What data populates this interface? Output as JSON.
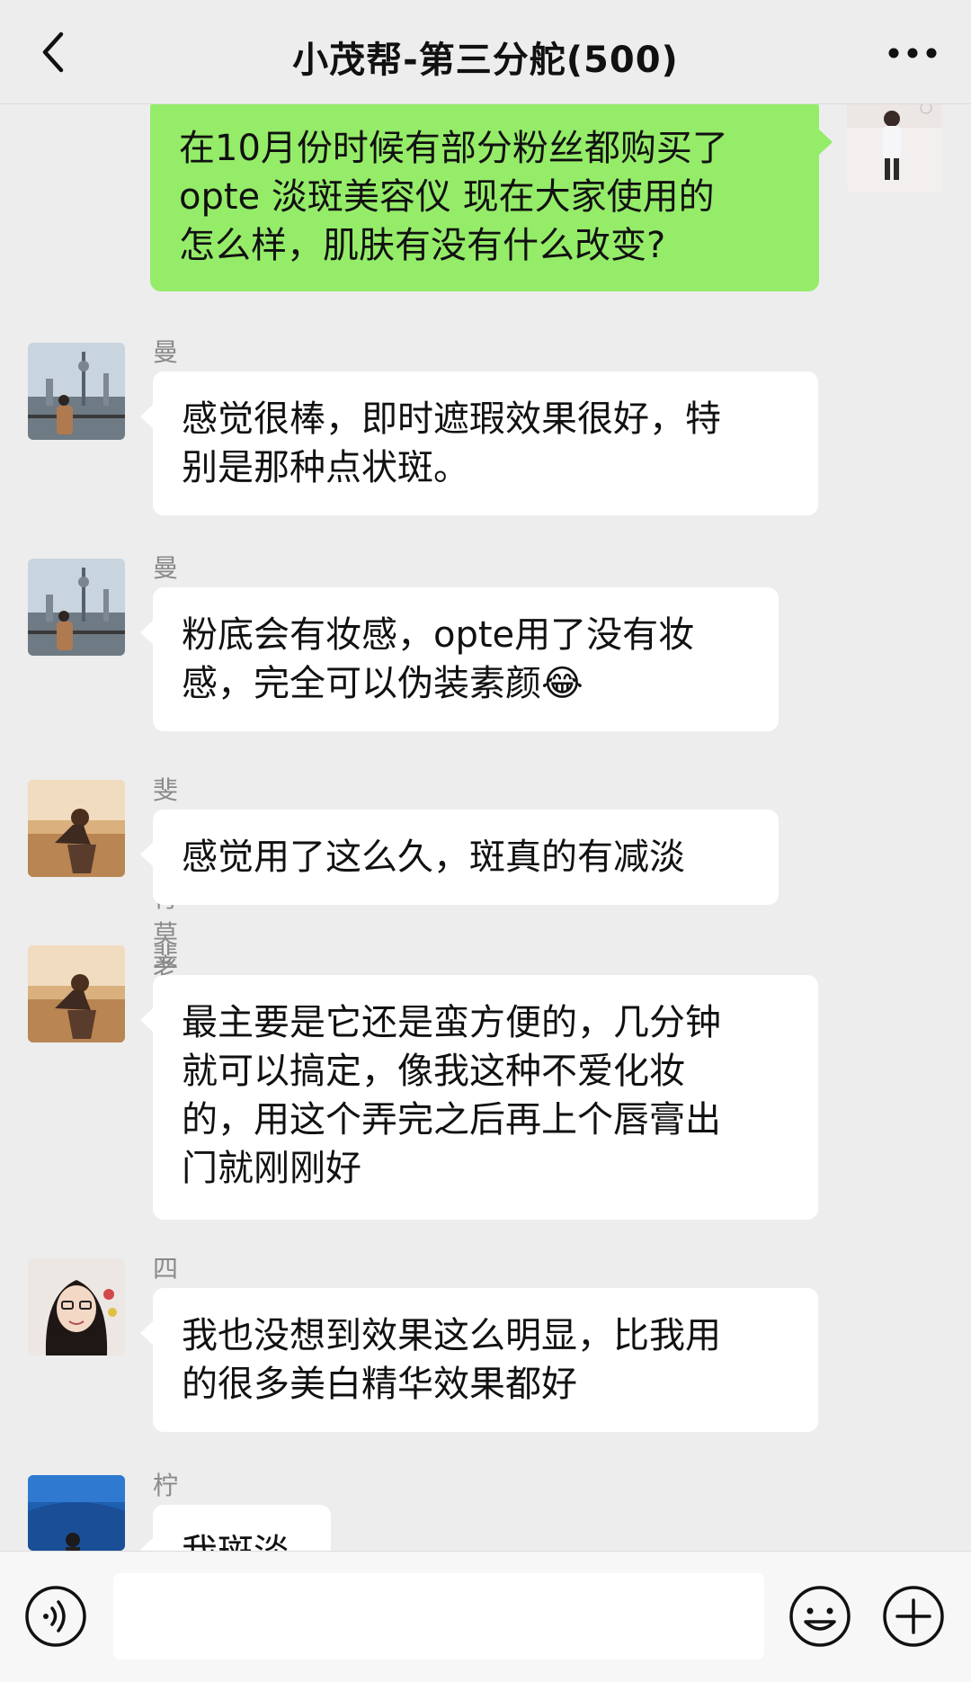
{
  "header": {
    "title": "小茂帮-第三分舵(500)",
    "back_icon": "chevron-left-icon",
    "more_icon": "more-dots-icon"
  },
  "messages": [
    {
      "mine": true,
      "text_lines": [
        "在10月份时候有部分粉丝都购买了",
        "opte 淡斑美容仪 现在大家使用的",
        "怎么样，肌肤有没有什么改变?"
      ]
    },
    {
      "sender": "曼丽",
      "text_lines": [
        "感觉很棒，即时遮瑕效果很好，特",
        "别是那种点状斑。"
      ]
    },
    {
      "sender": "曼丽",
      "text_lines": [
        "粉底会有妆感，opte用了没有妆",
        "感，完全可以伪装素颜"
      ],
      "emoji": "😂"
    },
    {
      "sender": "斐然教育莫老师",
      "text_lines": [
        "感觉用了这么久，斑真的有减淡"
      ]
    },
    {
      "sender": "斐然教育莫老师",
      "text_lines": [
        "最主要是它还是蛮方便的，几分钟",
        "就可以搞定，像我这种不爱化妆",
        "的，用这个弄完之后再上个唇膏出",
        "门就刚刚好"
      ]
    },
    {
      "sender": "四叶草",
      "text_lines": [
        "我也没想到效果这么明显，比我用",
        "的很多美白精华效果都好"
      ]
    },
    {
      "sender": "柠檬森林",
      "sender_emoji": "🍋",
      "text_lines": [
        "我斑淡"
      ]
    }
  ],
  "input_bar": {
    "voice_icon": "voice-icon",
    "emoji_icon": "emoji-icon",
    "plus_icon": "plus-icon",
    "input_value": ""
  },
  "colors": {
    "background": "#ededed",
    "my_bubble": "#95ec69",
    "other_bubble": "#ffffff",
    "sender_name": "#8a8a8a"
  }
}
